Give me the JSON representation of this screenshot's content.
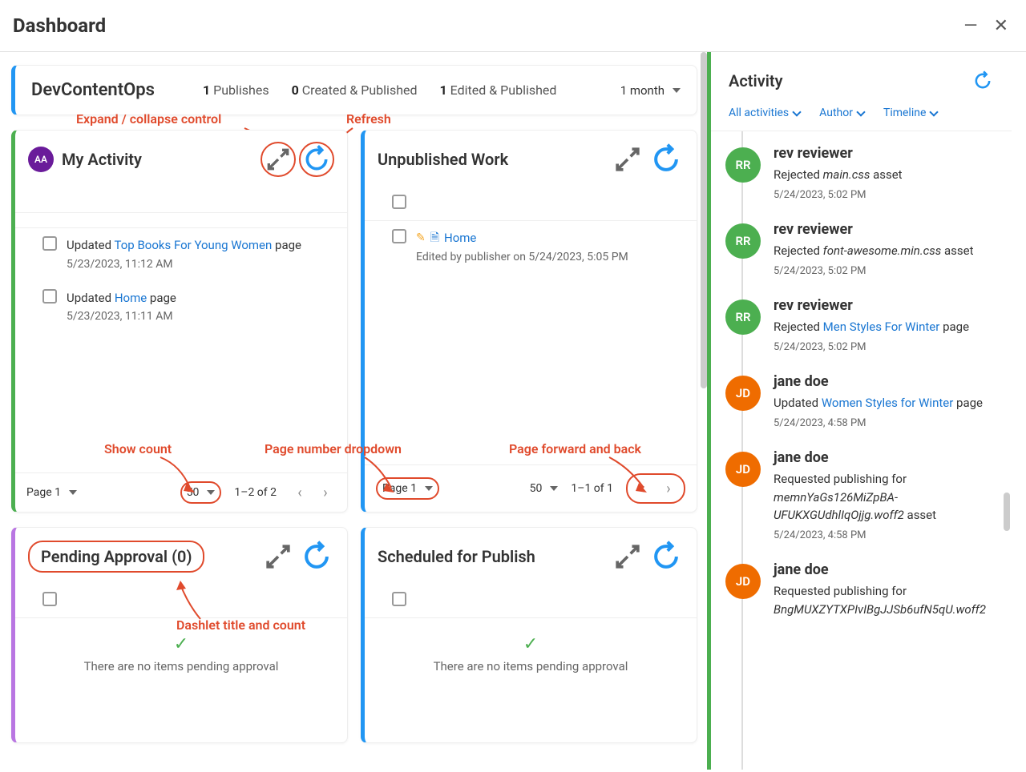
{
  "header": {
    "title": "Dashboard"
  },
  "stats": {
    "siteName": "DevContentOps",
    "publishes": "1 Publishes",
    "createdPublished": "0 Created & Published",
    "editedPublished": "1 Edited & Published",
    "range": "1 month"
  },
  "annotations": {
    "expandCollapse": "Expand / collapse control",
    "refresh": "Refresh",
    "showCount": "Show count",
    "pageDropdown": "Page number dropdown",
    "pageNav": "Page forward and back",
    "dashletTitle": "Dashlet title and count"
  },
  "myActivity": {
    "title": "My Activity",
    "avatar": "AA",
    "items": [
      {
        "prefix": "Updated ",
        "link": "Top Books For Young Women",
        "suffix": " page",
        "ts": "5/23/2023, 11:12 AM"
      },
      {
        "prefix": "Updated ",
        "link": "Home",
        "suffix": " page",
        "ts": "5/23/2023, 11:11 AM"
      }
    ],
    "pageLabel": "Page 1",
    "perPage": "50",
    "rangeText": "1–2 of 2"
  },
  "unpublished": {
    "title": "Unpublished Work",
    "item": {
      "name": "Home",
      "meta": "Edited by publisher on 5/24/2023, 5:05 PM"
    },
    "pageLabel": "Page 1",
    "perPage": "50",
    "rangeText": "1–1 of 1"
  },
  "pending": {
    "title": "Pending Approval (0)",
    "empty": "There are no items pending approval"
  },
  "scheduled": {
    "title": "Scheduled for Publish",
    "empty": "There are no items pending approval"
  },
  "activity": {
    "title": "Activity",
    "filters": [
      "All activities",
      "Author",
      "Timeline"
    ],
    "feed": [
      {
        "avatar": "RR",
        "color": "green",
        "name": "rev reviewer",
        "prefix": "Rejected ",
        "em": "main.css",
        "suffix": " asset",
        "ts": "5/24/2023, 5:02 PM"
      },
      {
        "avatar": "RR",
        "color": "green",
        "name": "rev reviewer",
        "prefix": "Rejected ",
        "em": "font-awesome.min.css",
        "suffix": " asset",
        "ts": "5/24/2023, 5:02 PM"
      },
      {
        "avatar": "RR",
        "color": "green",
        "name": "rev reviewer",
        "prefix": "Rejected ",
        "link": "Men Styles For Winter",
        "suffix": " page",
        "ts": "5/24/2023, 5:02 PM"
      },
      {
        "avatar": "JD",
        "color": "orange",
        "name": "jane doe",
        "prefix": "Updated ",
        "link": "Women Styles for Winter",
        "suffix": " page",
        "ts": "5/24/2023, 4:58 PM"
      },
      {
        "avatar": "JD",
        "color": "orange",
        "name": "jane doe",
        "prefix": "Requested publishing for ",
        "em": "memnYaGs126MiZpBA-UFUKXGUdhlIqOjjg.woff2",
        "suffix": " asset",
        "ts": "5/24/2023, 4:58 PM"
      },
      {
        "avatar": "JD",
        "color": "orange",
        "name": "jane doe",
        "prefix": "Requested publishing for ",
        "em": "BngMUXZYTXPIvIBgJJSb6ufN5qU.woff2",
        "suffix": "",
        "ts": ""
      }
    ]
  }
}
